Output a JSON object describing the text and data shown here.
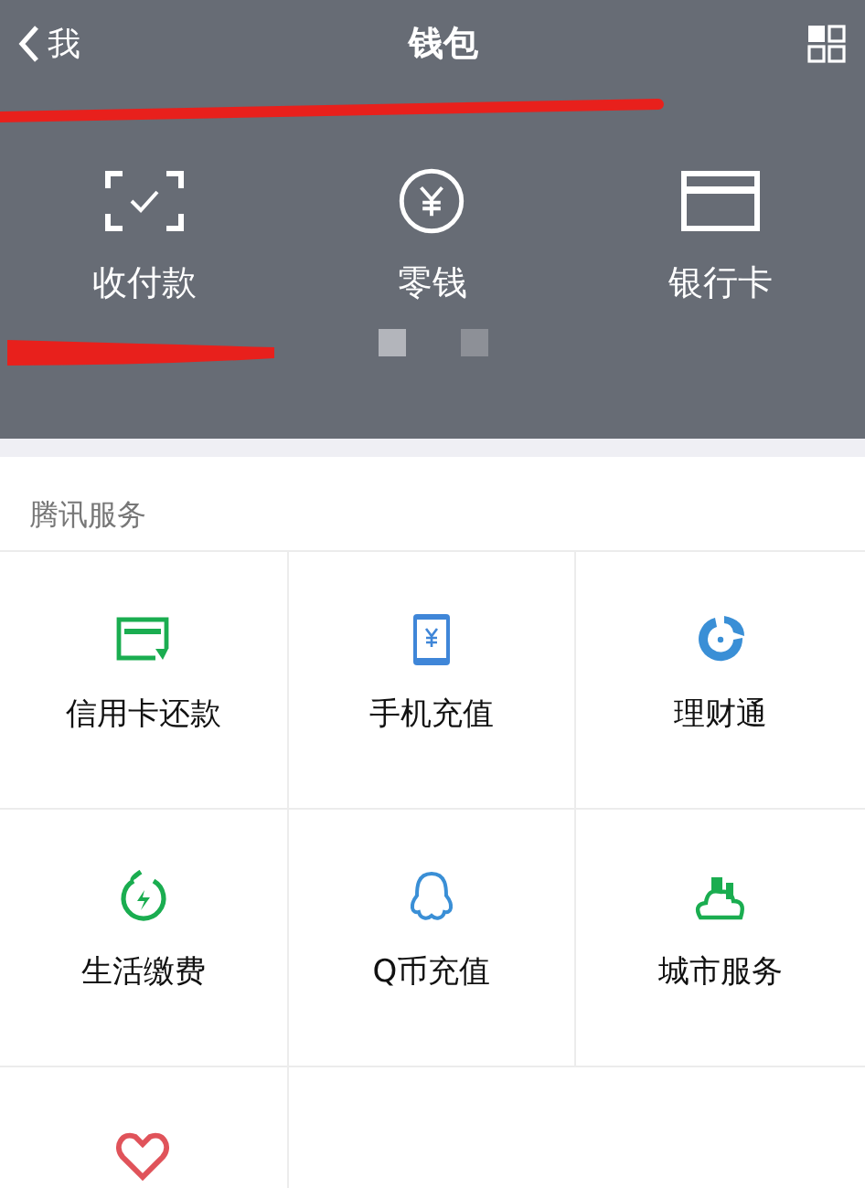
{
  "nav": {
    "back": "我",
    "title": "钱包"
  },
  "top_items": [
    {
      "label": "收付款"
    },
    {
      "label": "零钱"
    },
    {
      "label": "银行卡"
    }
  ],
  "pages": [
    {
      "selected": true
    },
    {
      "selected": false
    }
  ],
  "section_title": "腾讯服务",
  "services": [
    {
      "kind": "tile",
      "label": "信用卡还款"
    },
    {
      "kind": "tile",
      "label": "手机充值"
    },
    {
      "kind": "tile",
      "label": "理财通"
    },
    {
      "kind": "tile",
      "label": "生活缴费"
    },
    {
      "kind": "tile",
      "label": "Q币充值"
    },
    {
      "kind": "tile",
      "label": "城市服务"
    },
    {
      "kind": "tile"
    }
  ]
}
